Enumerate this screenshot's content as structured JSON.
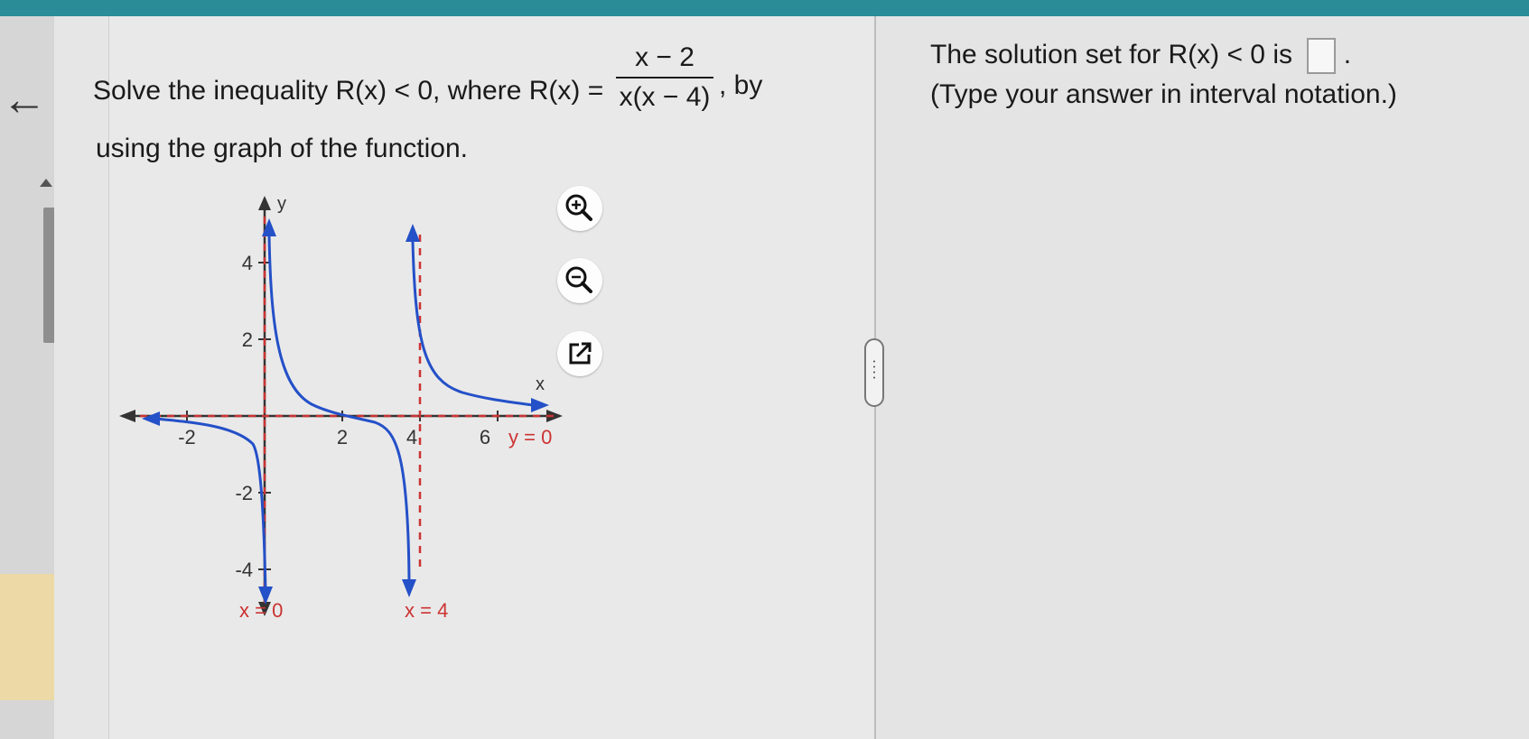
{
  "question": {
    "part1": "Solve the inequality R(x) < 0, where R(x) =",
    "numerator": "x − 2",
    "denominator": "x(x − 4)",
    "part2": ", by",
    "line2": "using the graph of the function."
  },
  "graph": {
    "x_ticks": [
      -2,
      2,
      4,
      6
    ],
    "y_ticks": [
      4,
      2,
      -2,
      -4
    ],
    "x_axis_label": "x",
    "y_axis_label": "y",
    "asymptote_labels": {
      "horizontal": "y = 0",
      "vertical_left": "x = 0",
      "vertical_right": "x = 4"
    },
    "colors": {
      "curve": "#2450c8",
      "asymptote": "#cc3333",
      "axis": "#333333"
    }
  },
  "tools": {
    "zoom_in": "zoom-in-icon",
    "zoom_out": "zoom-out-icon",
    "popout": "popout-icon"
  },
  "answer": {
    "prefix": "The solution set for R(x) < 0 is",
    "suffix": ".",
    "value": "",
    "hint": "(Type your answer in interval notation.)"
  },
  "colors": {
    "topbar": "#2a8c97",
    "tab": "#ecd9a6"
  }
}
